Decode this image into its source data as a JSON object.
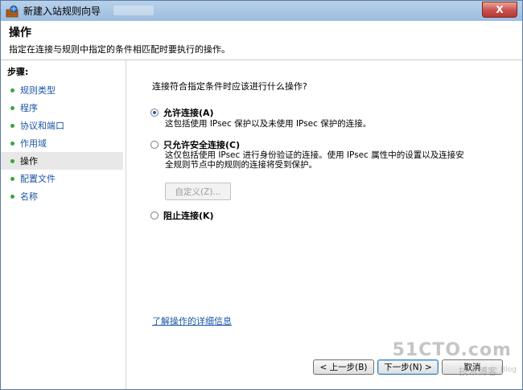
{
  "window": {
    "title": "新建入站规则向导",
    "close_label": "X",
    "icon": "firewall-shield-icon"
  },
  "header": {
    "title": "操作",
    "description": "指定在连接与规则中指定的条件相匹配时要执行的操作。"
  },
  "sidebar": {
    "heading": "步骤:",
    "items": [
      {
        "label": "规则类型",
        "active": false
      },
      {
        "label": "程序",
        "active": false
      },
      {
        "label": "协议和端口",
        "active": false
      },
      {
        "label": "作用域",
        "active": false
      },
      {
        "label": "操作",
        "active": true
      },
      {
        "label": "配置文件",
        "active": false
      },
      {
        "label": "名称",
        "active": false
      }
    ]
  },
  "main": {
    "question": "连接符合指定条件时应该进行什么操作?",
    "options": [
      {
        "label": "允许连接(A)",
        "description": "这包括使用 IPsec 保护以及未使用 IPsec 保护的连接。",
        "checked": true
      },
      {
        "label": "只允许安全连接(C)",
        "description_line1": "这仅包括使用 IPsec 进行身份验证的连接。使用 IPsec 属性中的设置以及连接安",
        "description_line2": "全规则节点中的规则的连接将受到保护。",
        "checked": false
      },
      {
        "label": "阻止连接(K)",
        "checked": false
      }
    ],
    "customize_label": "自定义(Z)...",
    "learn_more": "了解操作的详细信息"
  },
  "footer": {
    "back_label": "< 上一步(B)",
    "next_label": "下一步(N) >",
    "cancel_label": "取消"
  },
  "watermark": {
    "site": "51CTO.com",
    "text": "技术博客",
    "blog": "Blog"
  }
}
